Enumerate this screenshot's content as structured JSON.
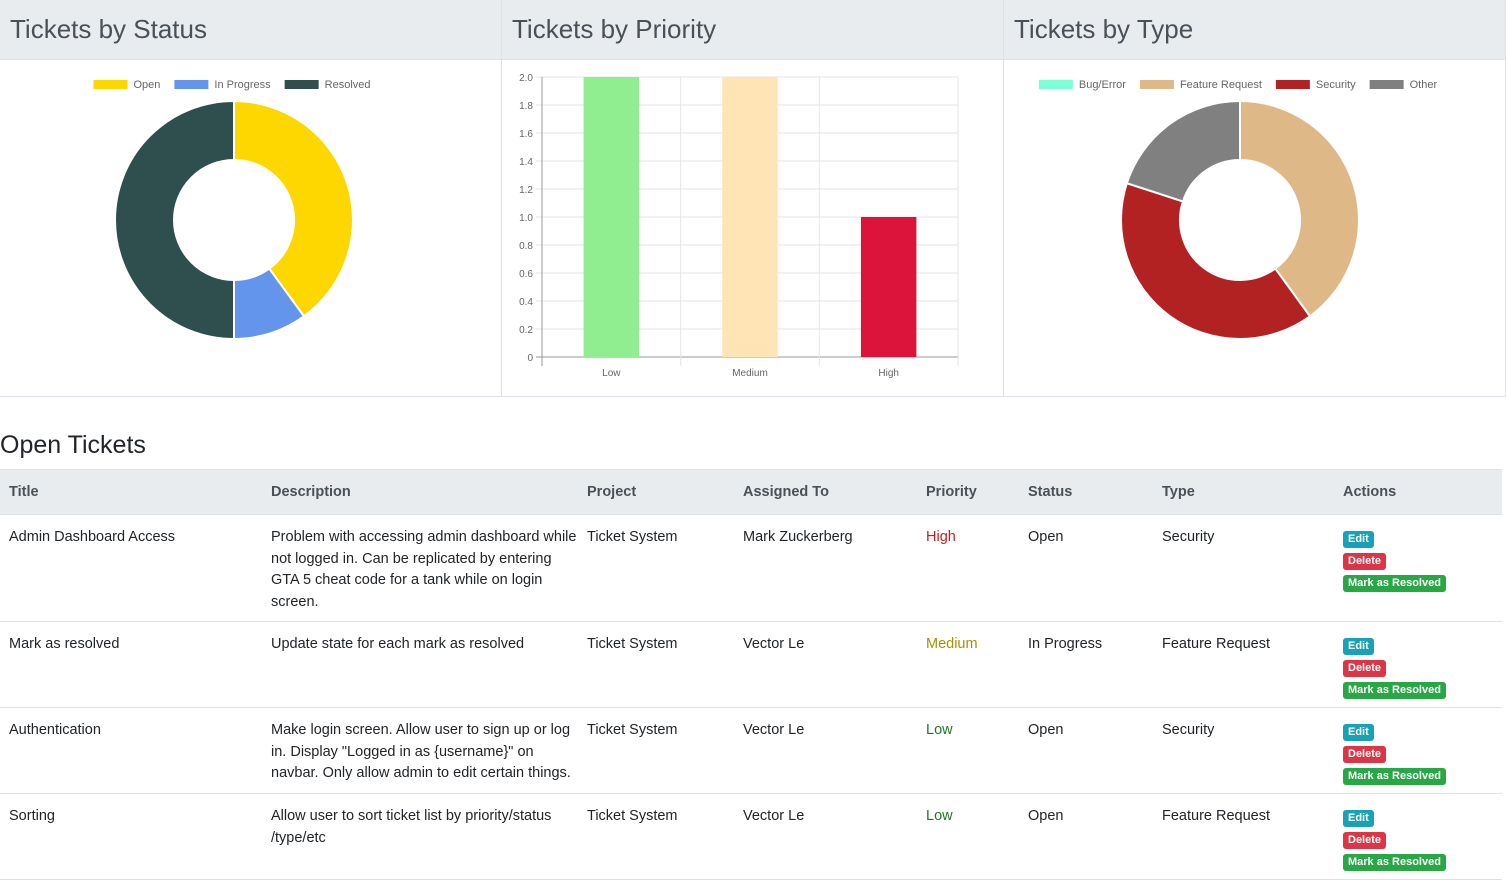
{
  "charts": {
    "status": {
      "header": "Tickets by Status"
    },
    "priority": {
      "header": "Tickets by Priority"
    },
    "type": {
      "header": "Tickets by Type"
    }
  },
  "chart_data": [
    {
      "type": "pie",
      "variant": "doughnut",
      "title": "Tickets by Status",
      "legend_position": "top",
      "categories": [
        "Open",
        "In Progress",
        "Resolved"
      ],
      "values": [
        4,
        1,
        5
      ],
      "colors": [
        "#ffd700",
        "#6495ed",
        "#2f4f4f"
      ]
    },
    {
      "type": "bar",
      "title": "Tickets by Priority",
      "categories": [
        "Low",
        "Medium",
        "High"
      ],
      "values": [
        2,
        2,
        1
      ],
      "colors": [
        "#90ee90",
        "#ffe4b5",
        "#dc143c"
      ],
      "ylim": [
        0,
        2
      ],
      "yticks": [
        "0",
        "0.2",
        "0.4",
        "0.6",
        "0.8",
        "1.0",
        "1.2",
        "1.4",
        "1.6",
        "1.8",
        "2.0"
      ],
      "grid": true
    },
    {
      "type": "pie",
      "variant": "doughnut",
      "title": "Tickets by Type",
      "legend_position": "top",
      "categories": [
        "Bug/Error",
        "Feature Request",
        "Security",
        "Other"
      ],
      "values": [
        0,
        2,
        2,
        1
      ],
      "colors": [
        "#7fffd4",
        "#deb887",
        "#b22222",
        "#808080"
      ]
    }
  ],
  "open_tickets": {
    "title": "Open Tickets",
    "columns": [
      "Title",
      "Description",
      "Project",
      "Assigned To",
      "Priority",
      "Status",
      "Type",
      "Actions"
    ],
    "actions": {
      "edit": "Edit",
      "delete": "Delete",
      "resolve": "Mark as Resolved"
    },
    "rows": [
      {
        "title": "Admin Dashboard Access",
        "description": "Problem with accessing admin dashboard while not logged in. Can be replicated by entering GTA 5 cheat code for a tank while on login screen.",
        "project": "Ticket System",
        "assigned": "Mark Zuckerberg",
        "priority": "High",
        "status": "Open",
        "type": "Security"
      },
      {
        "title": "Mark as resolved",
        "description": "Update state for each mark as resolved",
        "project": "Ticket System",
        "assigned": "Vector Le",
        "priority": "Medium",
        "status": "In Progress",
        "type": "Feature Request"
      },
      {
        "title": "Authentication",
        "description": "Make login screen. Allow user to sign up or log in. Display \"Logged in as {username}\" on navbar. Only allow admin to edit certain things.",
        "project": "Ticket System",
        "assigned": "Vector Le",
        "priority": "Low",
        "status": "Open",
        "type": "Security"
      },
      {
        "title": "Sorting",
        "description": "Allow user to sort ticket list by priority/status /type/etc",
        "project": "Ticket System",
        "assigned": "Vector Le",
        "priority": "Low",
        "status": "Open",
        "type": "Feature Request"
      }
    ]
  }
}
